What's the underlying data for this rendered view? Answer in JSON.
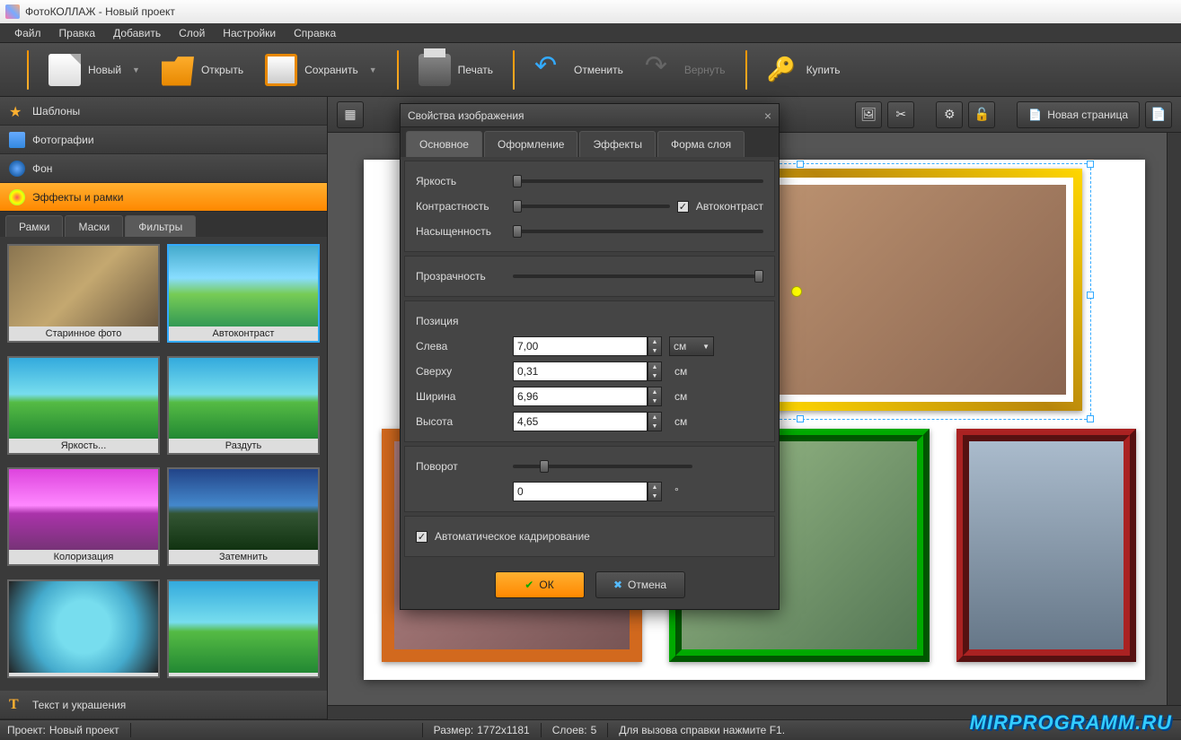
{
  "title": "ФотоКОЛЛАЖ - Новый проект",
  "menu": [
    "Файл",
    "Правка",
    "Добавить",
    "Слой",
    "Настройки",
    "Справка"
  ],
  "toolbar": {
    "new": "Новый",
    "open": "Открыть",
    "save": "Сохранить",
    "print": "Печать",
    "undo": "Отменить",
    "redo": "Вернуть",
    "buy": "Купить"
  },
  "sidebar": {
    "templates": "Шаблоны",
    "photos": "Фотографии",
    "background": "Фон",
    "effects": "Эффекты и рамки",
    "text": "Текст и украшения",
    "subtabs": {
      "frames": "Рамки",
      "masks": "Маски",
      "filters": "Фильтры"
    },
    "thumbs": [
      "Старинное фото",
      "Автоконтраст",
      "Яркость...",
      "Раздуть",
      "Колоризация",
      "Затемнить",
      "",
      ""
    ]
  },
  "canvastools": {
    "newpage": "Новая страница"
  },
  "dialog": {
    "title": "Свойства изображения",
    "tabs": {
      "main": "Основное",
      "design": "Оформление",
      "effects": "Эффекты",
      "shape": "Форма слоя"
    },
    "brightness": "Яркость",
    "contrast": "Контрастность",
    "saturation": "Насыщенность",
    "autocontrast": "Автоконтраст",
    "opacity": "Прозрачность",
    "position": "Позиция",
    "left": "Слева",
    "left_v": "7,00",
    "top": "Сверху",
    "top_v": "0,31",
    "width": "Ширина",
    "width_v": "6,96",
    "height": "Высота",
    "height_v": "4,65",
    "unit": "см",
    "rotation": "Поворот",
    "rotation_v": "0",
    "deg": "°",
    "autocrop": "Автоматическое кадрирование",
    "ok": "ОК",
    "cancel": "Отмена"
  },
  "status": {
    "project_l": "Проект:",
    "project_v": "Новый проект",
    "size_l": "Размер:",
    "size_v": "1772x1181",
    "layers_l": "Слоев:",
    "layers_v": "5",
    "help": "Для вызова справки нажмите F1."
  },
  "watermark": "MIRPROGRAMM.RU"
}
